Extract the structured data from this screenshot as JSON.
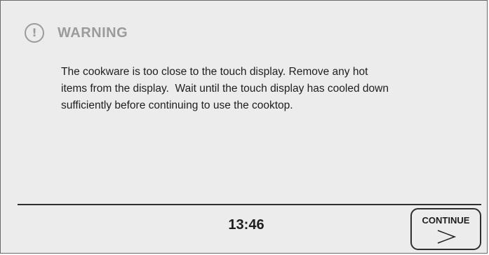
{
  "header": {
    "icon": "exclamation-circle-icon",
    "title": "WARNING"
  },
  "message": {
    "lines": [
      "The cookware is too close to the touch display. Remove any hot",
      "items from the display.  Wait until the touch display has cooled down",
      "sufficiently before continuing to use the cooktop."
    ]
  },
  "footer": {
    "time": "13:46",
    "continue_label": "CONTINUE",
    "continue_icon": "chevron-right-icon"
  },
  "colors": {
    "background": "#ececec",
    "header_gray": "#9b9b9b",
    "text": "#1e1e1e",
    "lines": "#2f2f2f"
  }
}
